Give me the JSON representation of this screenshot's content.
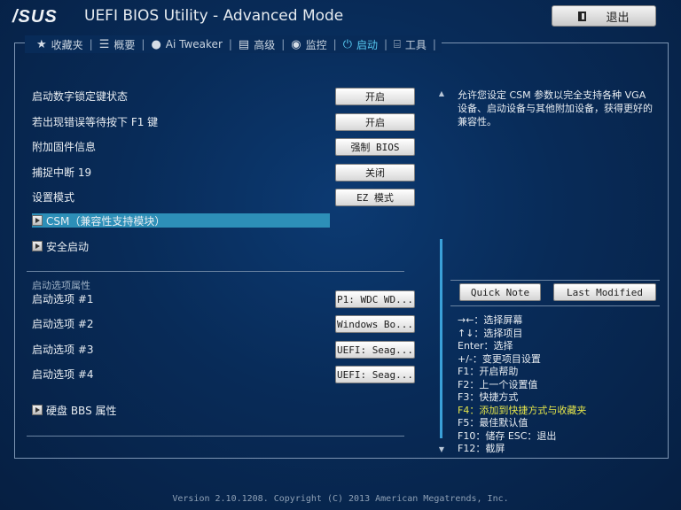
{
  "header": {
    "logo": "/SUS",
    "title": "UEFI BIOS Utility - Advanced Mode",
    "exit_label": "退出"
  },
  "tabs": [
    {
      "label": "收藏夹",
      "icon": "star-icon",
      "active": false
    },
    {
      "label": "概要",
      "icon": "list-icon",
      "active": false
    },
    {
      "label": "Ai Tweaker",
      "icon": "tweaker-icon",
      "active": false
    },
    {
      "label": "高级",
      "icon": "advanced-icon",
      "active": false
    },
    {
      "label": "监控",
      "icon": "monitor-icon",
      "active": false
    },
    {
      "label": "启动",
      "icon": "power-icon",
      "active": true
    },
    {
      "label": "工具",
      "icon": "tool-icon",
      "active": false
    }
  ],
  "settings": [
    {
      "label": "启动数字锁定键状态",
      "value": "开启"
    },
    {
      "label": "若出现错误等待按下 F1 键",
      "value": "开启"
    },
    {
      "label": "附加固件信息",
      "value": "强制 BIOS"
    },
    {
      "label": "捕捉中断 19",
      "value": "关闭"
    },
    {
      "label": "设置模式",
      "value": "EZ 模式"
    }
  ],
  "submenus": {
    "csm": "CSM（兼容性支持模块）",
    "secure_boot": "安全启动",
    "hdd_bbs": "硬盘 BBS 属性"
  },
  "boot_section": {
    "title": "启动选项属性",
    "options": [
      {
        "label": "启动选项 #1",
        "value": "P1: WDC WD..."
      },
      {
        "label": "启动选项 #2",
        "value": "Windows Bo..."
      },
      {
        "label": "启动选项 #3",
        "value": "UEFI: Seag..."
      },
      {
        "label": "启动选项 #4",
        "value": "UEFI: Seag..."
      }
    ]
  },
  "description": {
    "line1": "允许您设定 CSM 参数以完全支持各种 VGA",
    "line2": "设备、启动设备与其他附加设备，获得更好的兼容性。"
  },
  "quick_note_label": "Quick Note",
  "last_modified_label": "Last Modified",
  "keys": [
    "→←：选择屏幕",
    "↑↓：选择项目",
    "Enter：选择",
    "+/-：变更项目设置",
    "F1：开启帮助",
    "F2：上一个设置值",
    "F3：快捷方式",
    "F4：添加到快捷方式与收藏夹",
    "F5：最佳默认值",
    "F10：储存  ESC：退出",
    "F12：截屏"
  ],
  "footer": "Version 2.10.1208. Copyright (C) 2013 American Megatrends, Inc.",
  "colors": {
    "accent": "#56c8f0",
    "highlight": "#2d8fb8",
    "key_highlight": "#e5e54a"
  }
}
